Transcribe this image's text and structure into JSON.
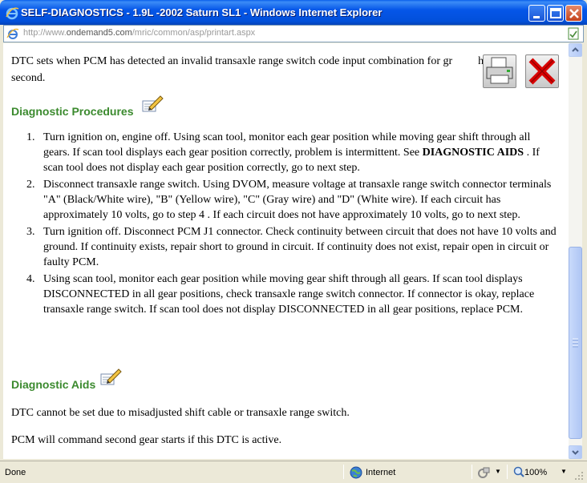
{
  "window": {
    "title": "SELF-DIAGNOSTICS - 1.9L -2002 Saturn SL1 - Windows Internet Explorer",
    "title_icon": "ie-logo-icon"
  },
  "address_bar": {
    "url_prefix": "http://www.",
    "url_domain": "ondemand5.com",
    "url_path": "/mric/common/asp/printart.aspx"
  },
  "page": {
    "intro_text": "DTC sets when PCM has detected an invalid transaxle range switch code input combination for gr",
    "intro_tail_hidden": "ha",
    "intro_second_line": "second.",
    "print_button_icon": "printer-icon",
    "close_button_icon": "close-x-icon",
    "procedures_heading": "Diagnostic Procedures",
    "procedures": [
      {
        "num": "1.",
        "text_before": "Turn ignition on, engine off. Using scan tool, monitor each gear position while moving gear shift through all gears. If scan tool displays each gear position correctly, problem is intermittent. See ",
        "bold": "DIAGNOSTIC AIDS",
        "text_after": " . If scan tool does not display each gear position correctly, go to next step."
      },
      {
        "num": "2.",
        "text": "Disconnect transaxle range switch. Using DVOM, measure voltage at transaxle range switch connector terminals \"A\" (Black/White wire), \"B\" (Yellow wire), \"C\" (Gray wire) and \"D\" (White wire). If each circuit has approximately 10 volts, go to step 4 . If each circuit does not have approximately 10 volts, go to next step."
      },
      {
        "num": "3.",
        "text": "Turn ignition off. Disconnect PCM J1 connector. Check continuity between circuit that does not have 10 volts and ground. If continuity exists, repair short to ground in circuit. If continuity does not exist, repair open in circuit or faulty PCM."
      },
      {
        "num": "4.",
        "text": "Using scan tool, monitor each gear position while moving gear shift through all gears. If scan tool displays DISCONNECTED in all gear positions, check transaxle range switch connector. If connector is okay, replace transaxle range switch. If scan tool does not display DISCONNECTED in all gear positions, replace PCM."
      }
    ],
    "aids_heading": "Diagnostic Aids",
    "aids_para1": "DTC cannot be set due to misadjusted shift cable or transaxle range switch.",
    "aids_para2": "PCM will command second gear starts if this DTC is active."
  },
  "status_bar": {
    "status_text": "Done",
    "zone": "Internet",
    "zoom": "100%"
  },
  "colors": {
    "heading_green": "#3B8A2E",
    "titlebar_blue": "#0556E8"
  }
}
